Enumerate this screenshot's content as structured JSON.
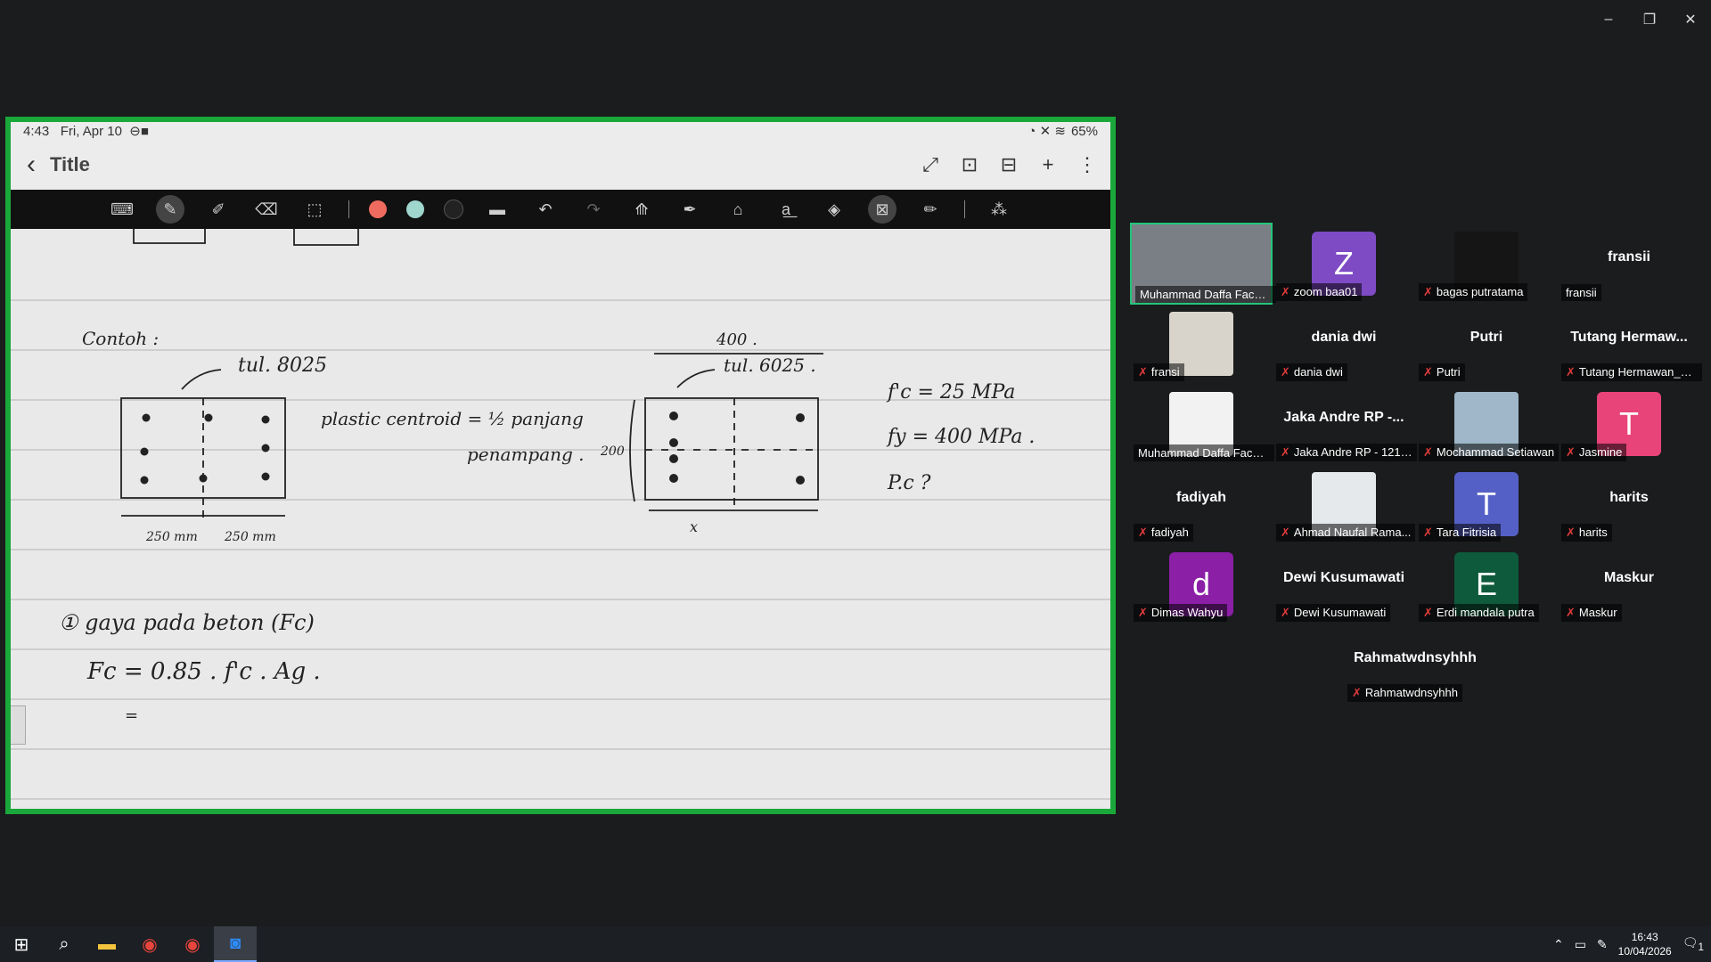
{
  "window": {
    "minimize": "–",
    "restore": "❐",
    "close": "✕"
  },
  "share": {
    "status_time": "4:43",
    "status_date": "Fri, Apr 10",
    "battery": "65%",
    "title": "Title",
    "back": "‹",
    "actions": [
      "⤢",
      "⊡",
      "⊟",
      "+",
      "⋮"
    ],
    "pen_colors": [
      "#f06b5f",
      "#9fd7cf",
      "#222222"
    ]
  },
  "note": {
    "contoh": "Contoh :",
    "tul1": "tul. 8025",
    "tul2": "tul. 6025 .",
    "plastic": "plastic centroid = ½ panjang",
    "penampang": "penampang .",
    "w400": "400 .",
    "h200": "200",
    "x": "x",
    "dim1": "250 mm",
    "dim2": "250 mm",
    "fc": "f'c = 25 MPa",
    "fy": "fy = 400 MPa .",
    "pc": "P.c ?",
    "gaya": "① gaya pada beton (Fc)",
    "formula": "Fc = 0.85 . f'c . Ag .",
    "eq": "="
  },
  "participants": [
    {
      "name": "Muhammad Daffa Fachr...",
      "type": "photo",
      "color": "#7a7f86",
      "muted": false,
      "active": true
    },
    {
      "name": "zoom baa01",
      "type": "avatar",
      "initial": "Z",
      "color": "#7e4bc4",
      "muted": true
    },
    {
      "name": "bagas putratama",
      "type": "photo",
      "color": "#151515",
      "muted": true
    },
    {
      "name": "fransii",
      "type": "text",
      "display": "fransii",
      "muted": false
    },
    {
      "name": "fransi",
      "type": "photo",
      "color": "#d8d4cc",
      "muted": true
    },
    {
      "name": "dania dwi",
      "type": "text",
      "display": "dania dwi",
      "muted": true
    },
    {
      "name": "Putri",
      "type": "text",
      "display": "Putri",
      "muted": true
    },
    {
      "name": "Tutang Hermawan_TSI",
      "type": "text",
      "display": "Tutang  Hermaw...",
      "muted": true
    },
    {
      "name": "Muhammad Daffa Fachr...",
      "type": "photo",
      "color": "#f2f2f2",
      "muted": false
    },
    {
      "name": "Jaka Andre RP - 1212...",
      "type": "text",
      "display": "Jaka Andre RP -...",
      "muted": true
    },
    {
      "name": "Mochammad Setiawan",
      "type": "photo",
      "color": "#9fb7c8",
      "muted": true
    },
    {
      "name": "Jasmine",
      "type": "avatar",
      "initial": "T",
      "color": "#e8447a",
      "muted": true
    },
    {
      "name": "fadiyah",
      "type": "text",
      "display": "fadiyah",
      "muted": true
    },
    {
      "name": "Ahmad Naufal Rama...",
      "type": "photo",
      "color": "#e6e9ec",
      "muted": true
    },
    {
      "name": "Tara Fitrisia",
      "type": "avatar",
      "initial": "T",
      "color": "#5560c6",
      "muted": true
    },
    {
      "name": "harits",
      "type": "text",
      "display": "harits",
      "muted": true
    },
    {
      "name": "Dimas Wahyu",
      "type": "avatar",
      "initial": "d",
      "color": "#8b1fa6",
      "muted": true
    },
    {
      "name": "Dewi Kusumawati",
      "type": "text",
      "display": "Dewi Kusumawati",
      "muted": true
    },
    {
      "name": "Erdi mandala putra",
      "type": "avatar",
      "initial": "E",
      "color": "#0e5a3c",
      "muted": true
    },
    {
      "name": "Maskur",
      "type": "text",
      "display": "Maskur",
      "muted": true
    },
    {
      "name": "Rahmatwdnsyhhh",
      "type": "text",
      "display": "Rahmatwdnsyhhh",
      "muted": true
    }
  ],
  "taskbar": {
    "time": "16:43",
    "date": "10/04/2026",
    "notif": "1"
  }
}
